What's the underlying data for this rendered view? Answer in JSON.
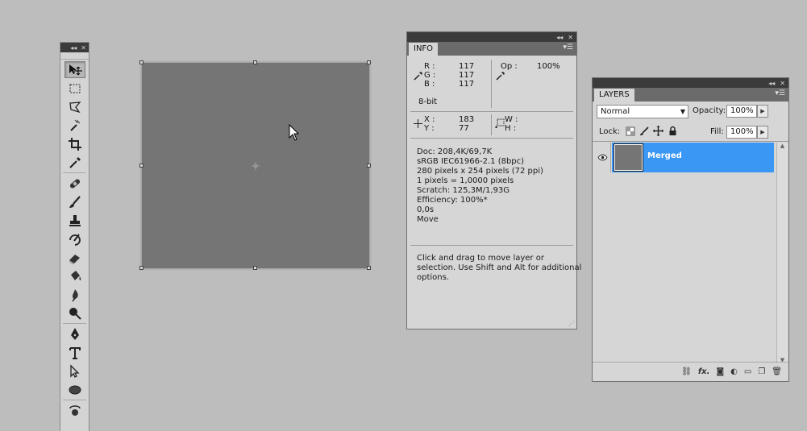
{
  "info": {
    "tab": "INFO",
    "rgb": {
      "r_label": "R :",
      "g_label": "G :",
      "b_label": "B :",
      "r": "117",
      "g": "117",
      "b": "117"
    },
    "op_label": "Op :",
    "op_value": "100%",
    "bit_depth": "8-bit",
    "xy": {
      "x_label": "X :",
      "y_label": "Y :",
      "x": "183",
      "y": "77"
    },
    "wh": {
      "w_label": "W :",
      "h_label": "H :"
    },
    "doc_lines": [
      "Doc: 208,4K/69,7K",
      "sRGB IEC61966-2.1 (8bpc)",
      "280 pixels x 254 pixels (72 ppi)",
      "1 pixels = 1,0000 pixels",
      "Scratch: 125,3M/1,93G",
      "Efficiency: 100%*",
      "0,0s",
      "Move"
    ],
    "hint_lines": [
      "Click and drag to move layer or",
      "selection.  Use Shift and Alt for additional",
      "options."
    ]
  },
  "layers": {
    "tab": "LAYERS",
    "blend_mode": "Normal",
    "opacity_label": "Opacity:",
    "opacity": "100%",
    "lock_label": "Lock:",
    "fill_label": "Fill:",
    "fill": "100%",
    "layer_name": "Merged",
    "bottom_icons": [
      "link-icon",
      "fx-icon",
      "mask-icon",
      "adjustment-icon",
      "folder-icon",
      "new-layer-icon",
      "trash-icon"
    ],
    "fx_text": "fx."
  },
  "colors": {
    "background": "#bdbdbd",
    "canvas": "#757575",
    "selected_layer": "#3a97f4"
  }
}
